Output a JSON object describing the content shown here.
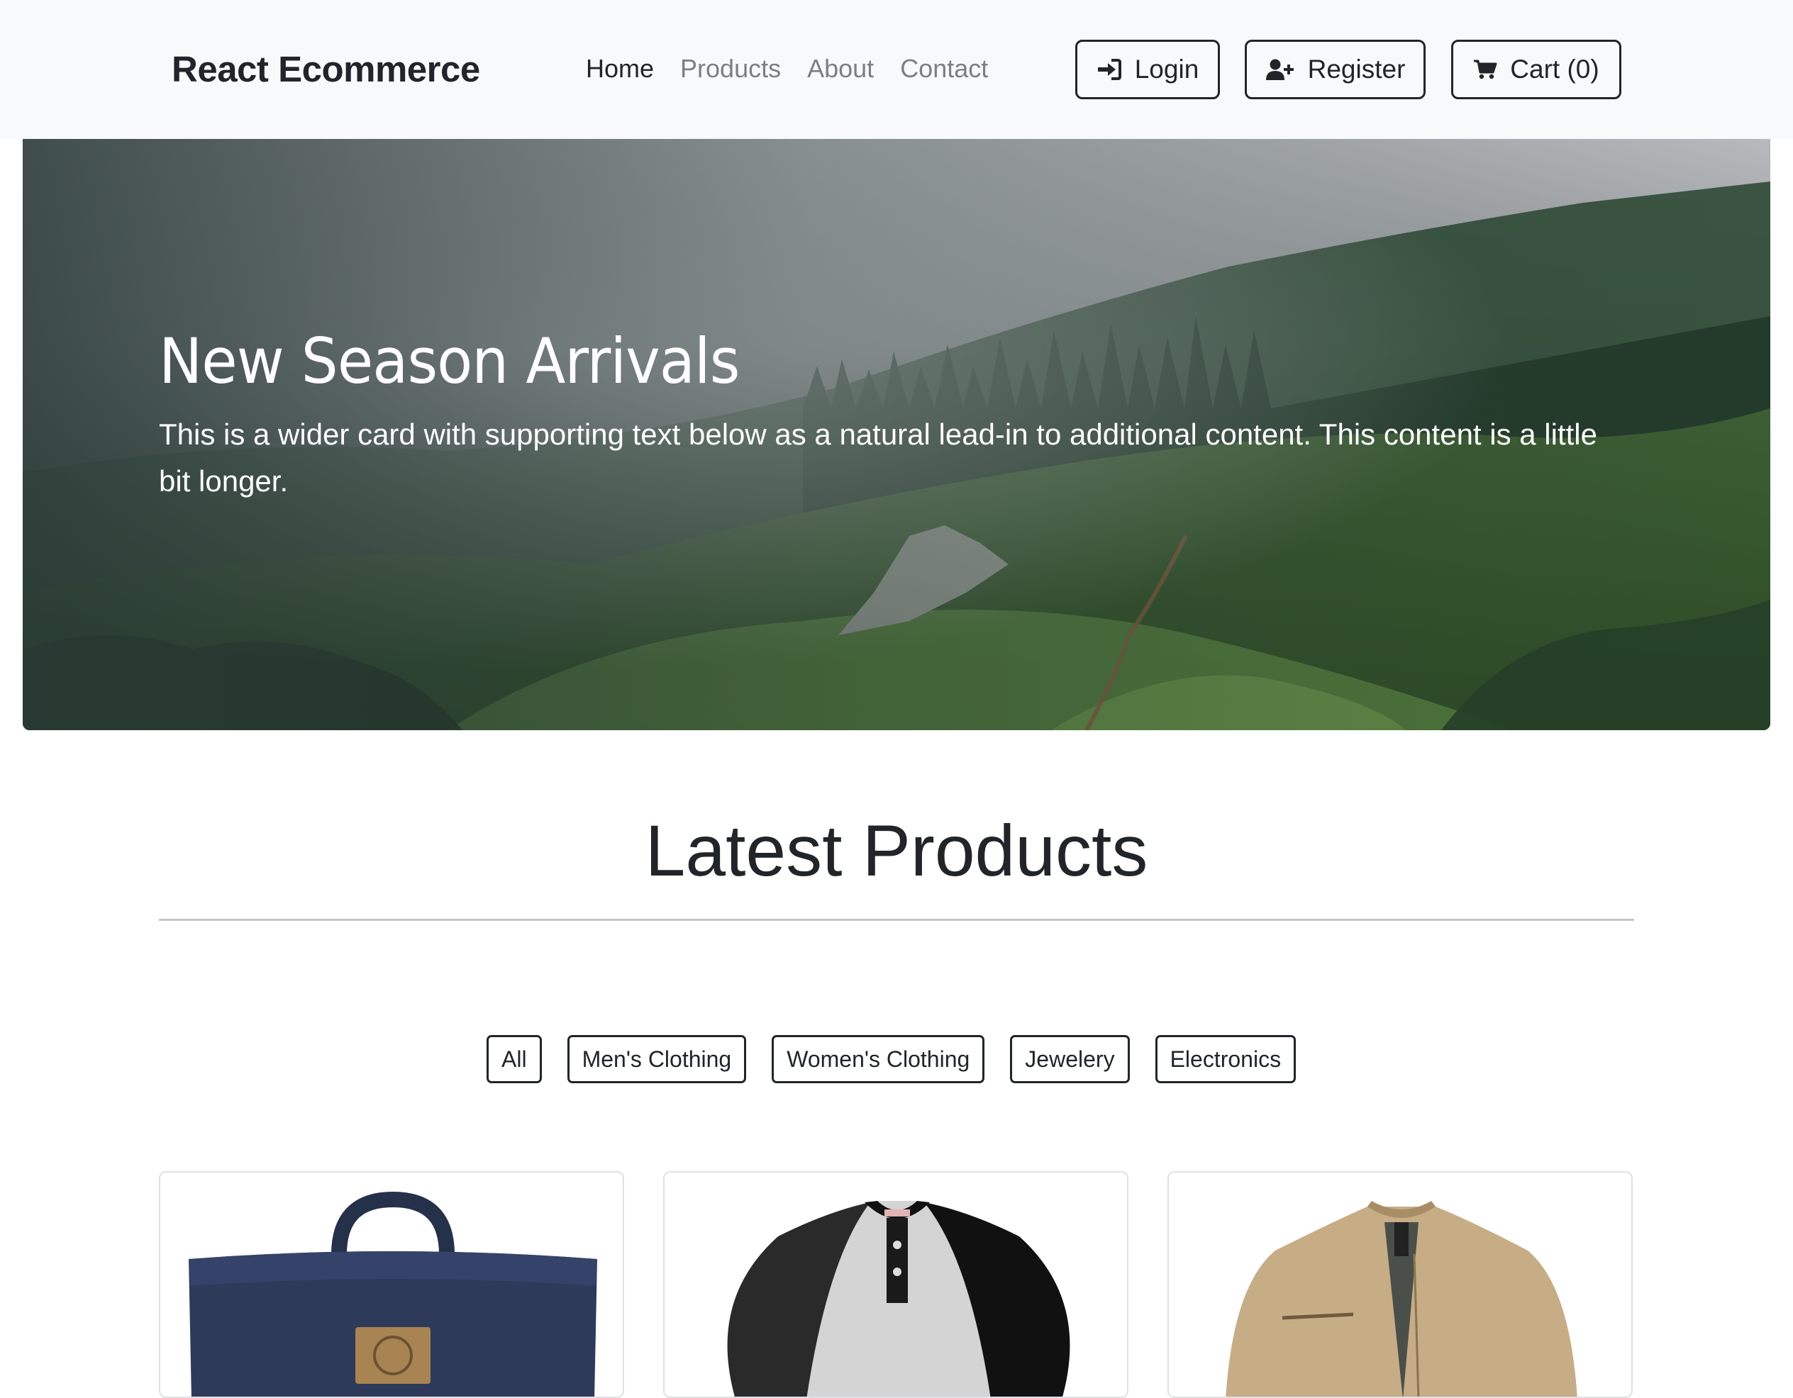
{
  "navbar": {
    "brand": "React Ecommerce",
    "links": [
      {
        "label": "Home",
        "active": true
      },
      {
        "label": "Products",
        "active": false
      },
      {
        "label": "About",
        "active": false
      },
      {
        "label": "Contact",
        "active": false
      }
    ],
    "buttons": {
      "login": {
        "label": "Login",
        "icon": "sign-in-icon"
      },
      "register": {
        "label": "Register",
        "icon": "user-plus-icon"
      },
      "cart": {
        "label": "Cart (0)",
        "icon": "shopping-cart-icon"
      }
    }
  },
  "hero": {
    "title": "New Season Arrivals",
    "text": "This is a wider card with supporting text below as a natural lead-in to additional content. This content is a little bit longer."
  },
  "products_section": {
    "title": "Latest Products",
    "filters": [
      "All",
      "Men's Clothing",
      "Women's Clothing",
      "Jewelery",
      "Electronics"
    ]
  },
  "colors": {
    "navbar_bg": "#f8f9fa",
    "text_dark": "#212529",
    "nav_muted": "#7b7f83"
  }
}
